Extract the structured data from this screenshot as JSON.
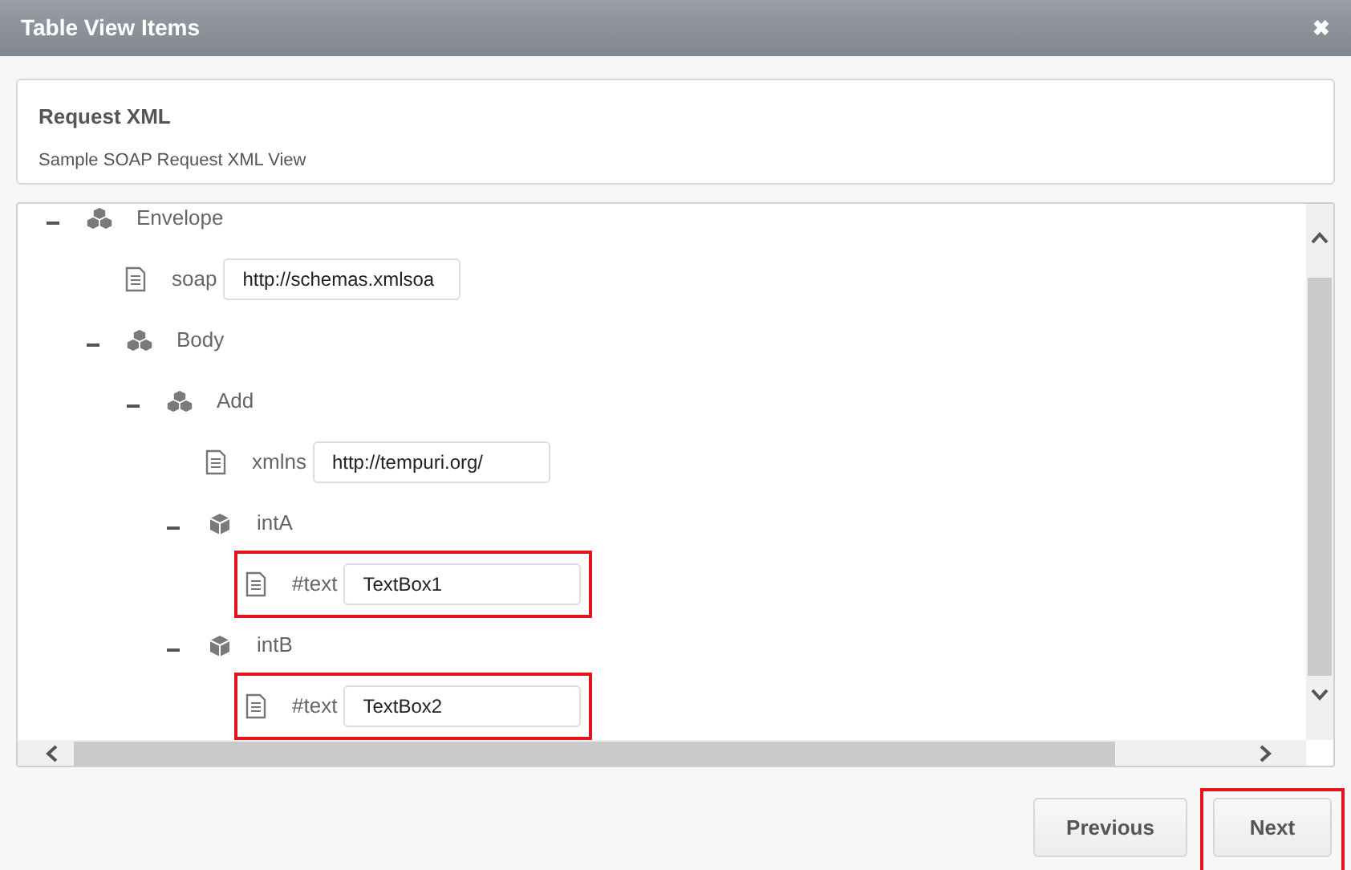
{
  "window": {
    "title": "Table View Items",
    "close": "✖"
  },
  "card": {
    "title": "Request XML",
    "subtitle": "Sample SOAP Request XML View"
  },
  "tree": [
    {
      "kind": "complex",
      "label": "Envelope",
      "expanded": true,
      "children": [
        {
          "kind": "attribute",
          "label": "soap",
          "value": "http://schemas.xmlsoa",
          "highlighted": false
        },
        {
          "kind": "complex",
          "label": "Body",
          "expanded": true,
          "children": [
            {
              "kind": "complex",
              "label": "Add",
              "expanded": true,
              "children": [
                {
                  "kind": "attribute",
                  "label": "xmlns",
                  "value": "http://tempuri.org/",
                  "highlighted": false
                },
                {
                  "kind": "simple",
                  "label": "intA",
                  "expanded": true,
                  "children": [
                    {
                      "kind": "attribute",
                      "label": "#text",
                      "value": "TextBox1",
                      "highlighted": true
                    }
                  ]
                },
                {
                  "kind": "simple",
                  "label": "intB",
                  "expanded": true,
                  "children": [
                    {
                      "kind": "attribute",
                      "label": "#text",
                      "value": "TextBox2",
                      "highlighted": true
                    }
                  ]
                }
              ]
            }
          ]
        }
      ]
    }
  ],
  "buttons": [
    {
      "label": "Previous",
      "highlighted": false
    },
    {
      "label": "Next",
      "highlighted": true
    }
  ]
}
